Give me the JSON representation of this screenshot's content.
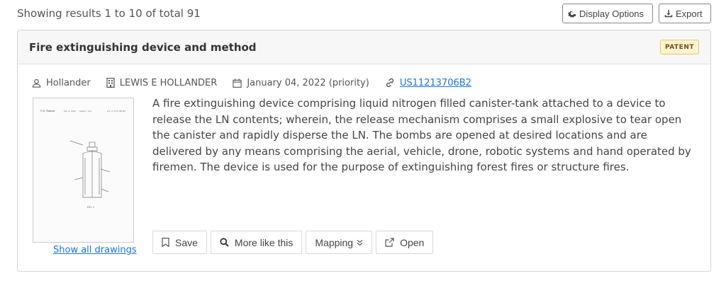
{
  "header": {
    "results_text": "Showing results 1 to 10 of total 91",
    "display_options_label": "Display Options",
    "export_label": "Export"
  },
  "result": {
    "title": "Fire extinguishing device and method",
    "badge": "PATENT",
    "assignee": "Hollander",
    "inventor": "LEWIS E HOLLANDER",
    "date": "January 04, 2022 (priority)",
    "patent_number": "US11213706B2",
    "abstract": "A fire extinguishing device comprising liquid nitrogen filled canister-tank attached to a device to release the LN contents; wherein, the release mechanism comprises a small explosive to tear open the canister and rapidly disperse the LN. The bombs are opened at desired locations and are delivered by any means comprising the aerial, vehicle, drone, robotic systems and hand operated by firemen. The device is used for the purpose of extinguishing forest fires or structure fires.",
    "show_drawings_label": "Show all drawings",
    "drawing": {
      "header_left": "U.S. Patent",
      "header_mid": "Jan. 4, 2022",
      "header_sheet": "Sheet 1 of 8",
      "header_right": "US 11,213,706 B2",
      "caption": "FIG. 1"
    }
  },
  "actions": {
    "save_label": "Save",
    "more_like_label": "More like this",
    "mapping_label": "Mapping",
    "open_label": "Open"
  },
  "colors": {
    "link": "#1a73e8",
    "badge_bg": "#fcf3cf",
    "badge_border": "#e8c96a"
  }
}
